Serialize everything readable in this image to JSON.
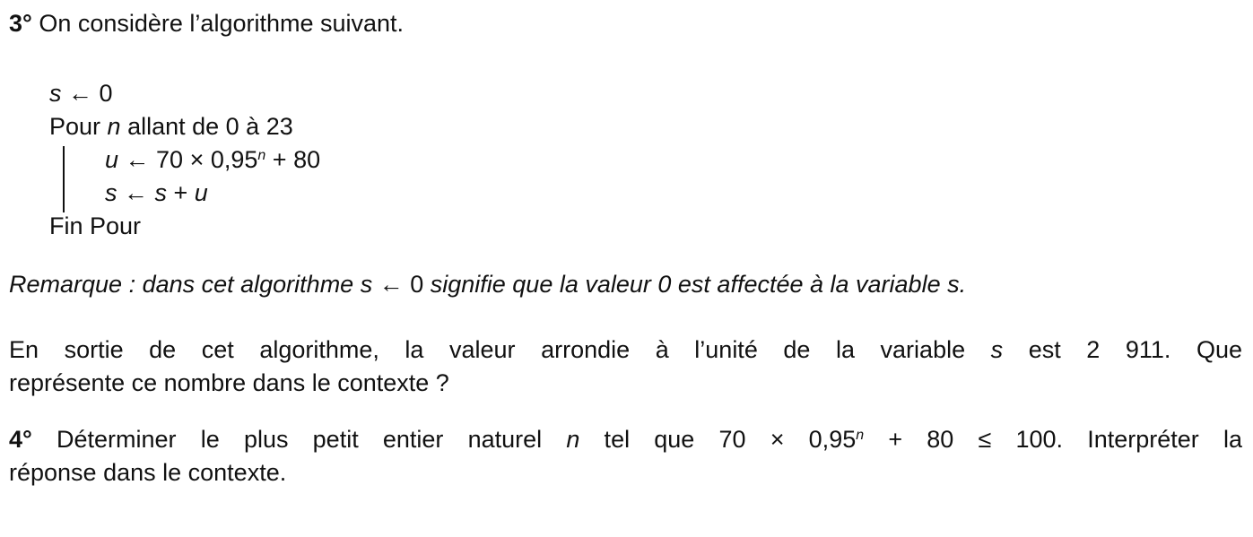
{
  "q3": {
    "number": "3°",
    "intro": "On considère l’algorithme suivant."
  },
  "algorithm": {
    "line1": {
      "var": "s",
      "op": " ← 0"
    },
    "line2": {
      "a": "Pour ",
      "var": "n",
      "b": " allant de 0 à 23"
    },
    "line3": {
      "var": "u",
      "a": " ← 70 × 0,95",
      "exp": "n",
      "b": " + 80"
    },
    "line4": {
      "var": "s",
      "a": " ← ",
      "var2": "s",
      "b": " + ",
      "var3": "u"
    },
    "line5": "Fin Pour"
  },
  "remark": {
    "a": "Remarque : dans cet algorithme s ← ",
    "zero": "0",
    "b": " signifie que la valeur 0 est affectée à la variable s."
  },
  "question3": {
    "line1a": "En sortie de cet algorithme, la valeur arrondie à l’unité de la variable ",
    "var": "s",
    "line1b": " est 2 911. Que",
    "line2": "représente ce nombre dans le contexte ?"
  },
  "q4": {
    "number": "4°",
    "a": " Déterminer le plus petit entier naturel ",
    "var": "n",
    "b": " tel que 70 × 0,95",
    "exp": "n",
    "c": " + 80 ≤ 100. Interpréter la",
    "line2": "réponse dans le contexte."
  }
}
